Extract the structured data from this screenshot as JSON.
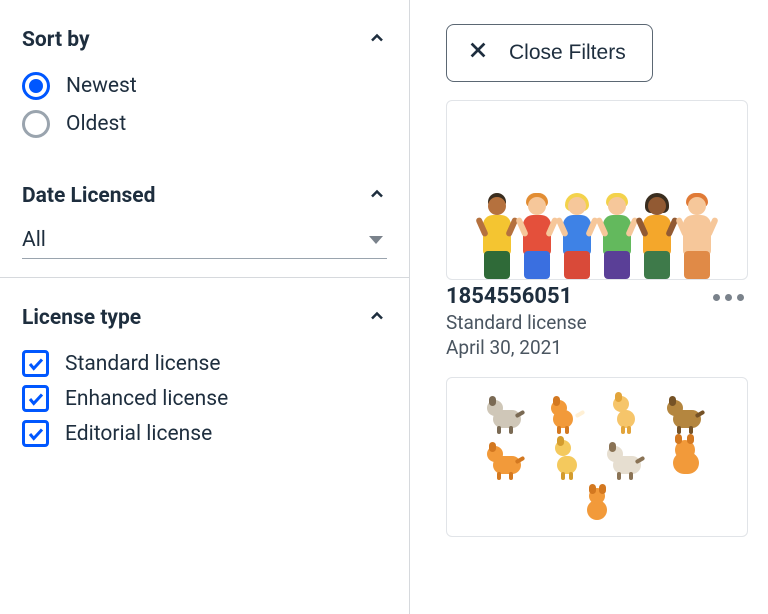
{
  "sidebar": {
    "sort": {
      "title": "Sort by",
      "options": [
        {
          "id": "newest",
          "label": "Newest",
          "selected": true
        },
        {
          "id": "oldest",
          "label": "Oldest",
          "selected": false
        }
      ]
    },
    "date_licensed": {
      "title": "Date Licensed",
      "value": "All"
    },
    "license_type": {
      "title": "License type",
      "options": [
        {
          "id": "standard",
          "label": "Standard license",
          "checked": true
        },
        {
          "id": "enhanced",
          "label": "Enhanced license",
          "checked": true
        },
        {
          "id": "editorial",
          "label": "Editorial license",
          "checked": true
        }
      ]
    }
  },
  "content": {
    "close_filters_label": "Close Filters",
    "assets": [
      {
        "id": "1854556051",
        "license": "Standard license",
        "date": "April 30, 2021",
        "thumb": "people"
      },
      {
        "id": "",
        "license": "",
        "date": "",
        "thumb": "dogs"
      }
    ]
  },
  "colors": {
    "primary": "#0057ff"
  }
}
